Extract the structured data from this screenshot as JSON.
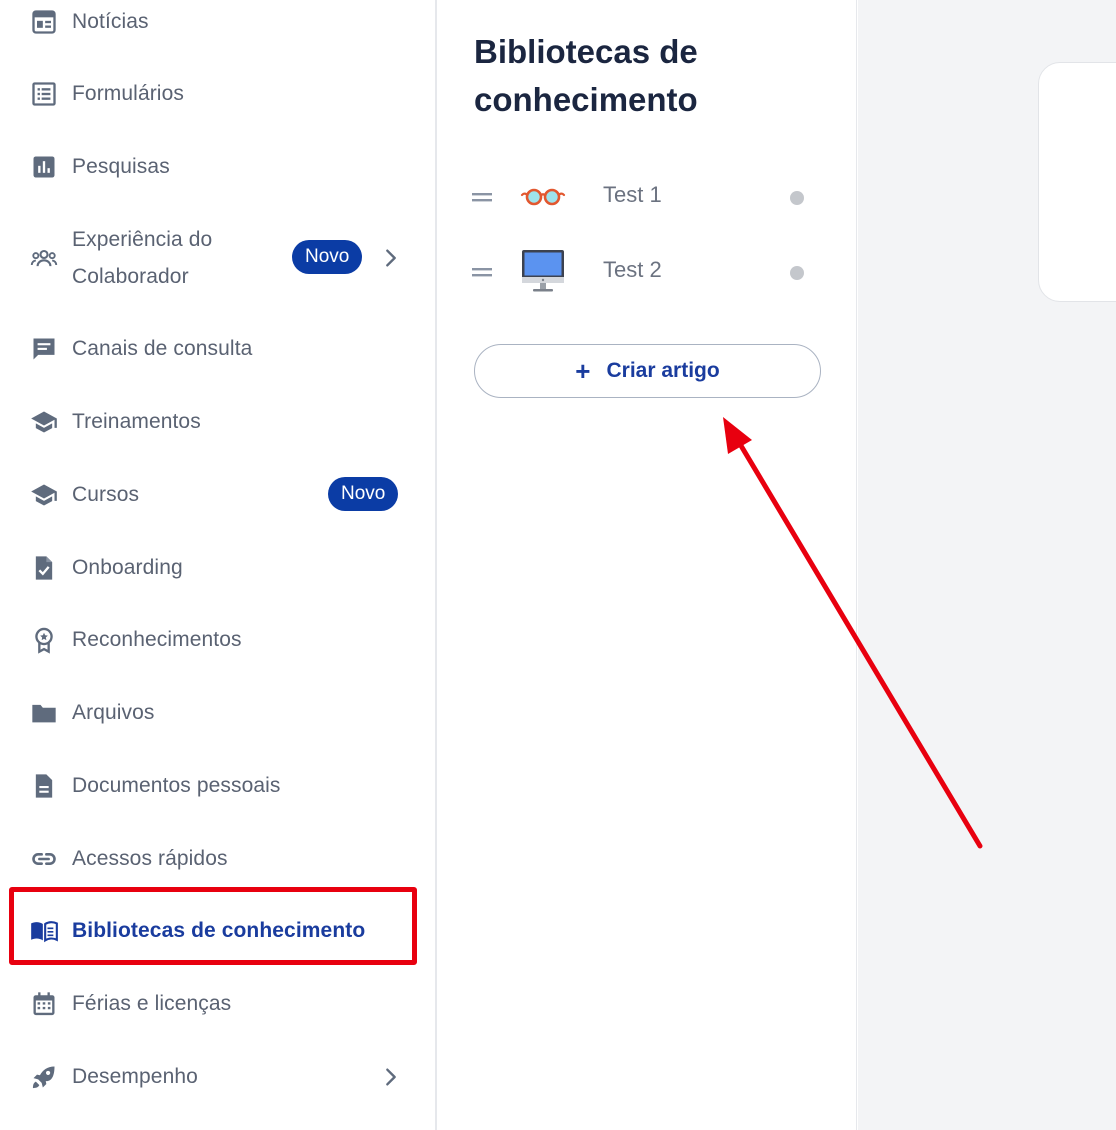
{
  "sidebar": {
    "items": [
      {
        "label": "Notícias",
        "icon": "newspaper-icon"
      },
      {
        "label": "Formulários",
        "icon": "form-list-icon"
      },
      {
        "label": "Pesquisas",
        "icon": "bar-chart-icon"
      },
      {
        "label": "Experiência do Colaborador",
        "icon": "team-icon",
        "badge": "Novo"
      },
      {
        "label": "Canais de consulta",
        "icon": "chat-icon"
      },
      {
        "label": "Treinamentos",
        "icon": "graduation-cap-icon"
      },
      {
        "label": "Cursos",
        "icon": "graduation-cap-icon",
        "badge": "Novo"
      },
      {
        "label": "Onboarding",
        "icon": "document-check-icon"
      },
      {
        "label": "Reconhecimentos",
        "icon": "award-ribbon-icon"
      },
      {
        "label": "Arquivos",
        "icon": "folder-icon"
      },
      {
        "label": "Documentos pessoais",
        "icon": "document-icon"
      },
      {
        "label": "Acessos rápidos",
        "icon": "link-icon"
      },
      {
        "label": "Bibliotecas de conhecimento",
        "icon": "open-book-icon",
        "active": true
      },
      {
        "label": "Férias e licenças",
        "icon": "calendar-icon"
      },
      {
        "label": "Desempenho",
        "icon": "rocket-icon"
      }
    ]
  },
  "panel": {
    "title": "Bibliotecas de conhecimento",
    "articles": [
      {
        "name": "Test 1",
        "emoji": "eyeglasses-icon"
      },
      {
        "name": "Test 2",
        "emoji": "desktop-computer-icon"
      }
    ],
    "create_button": {
      "label": "Criar artigo",
      "icon": "plus-icon"
    }
  },
  "colors": {
    "accent": "#0b3ca5",
    "active_text": "#1a3c9e",
    "annotation": "#e8000f",
    "muted_text": "#5a6272"
  }
}
